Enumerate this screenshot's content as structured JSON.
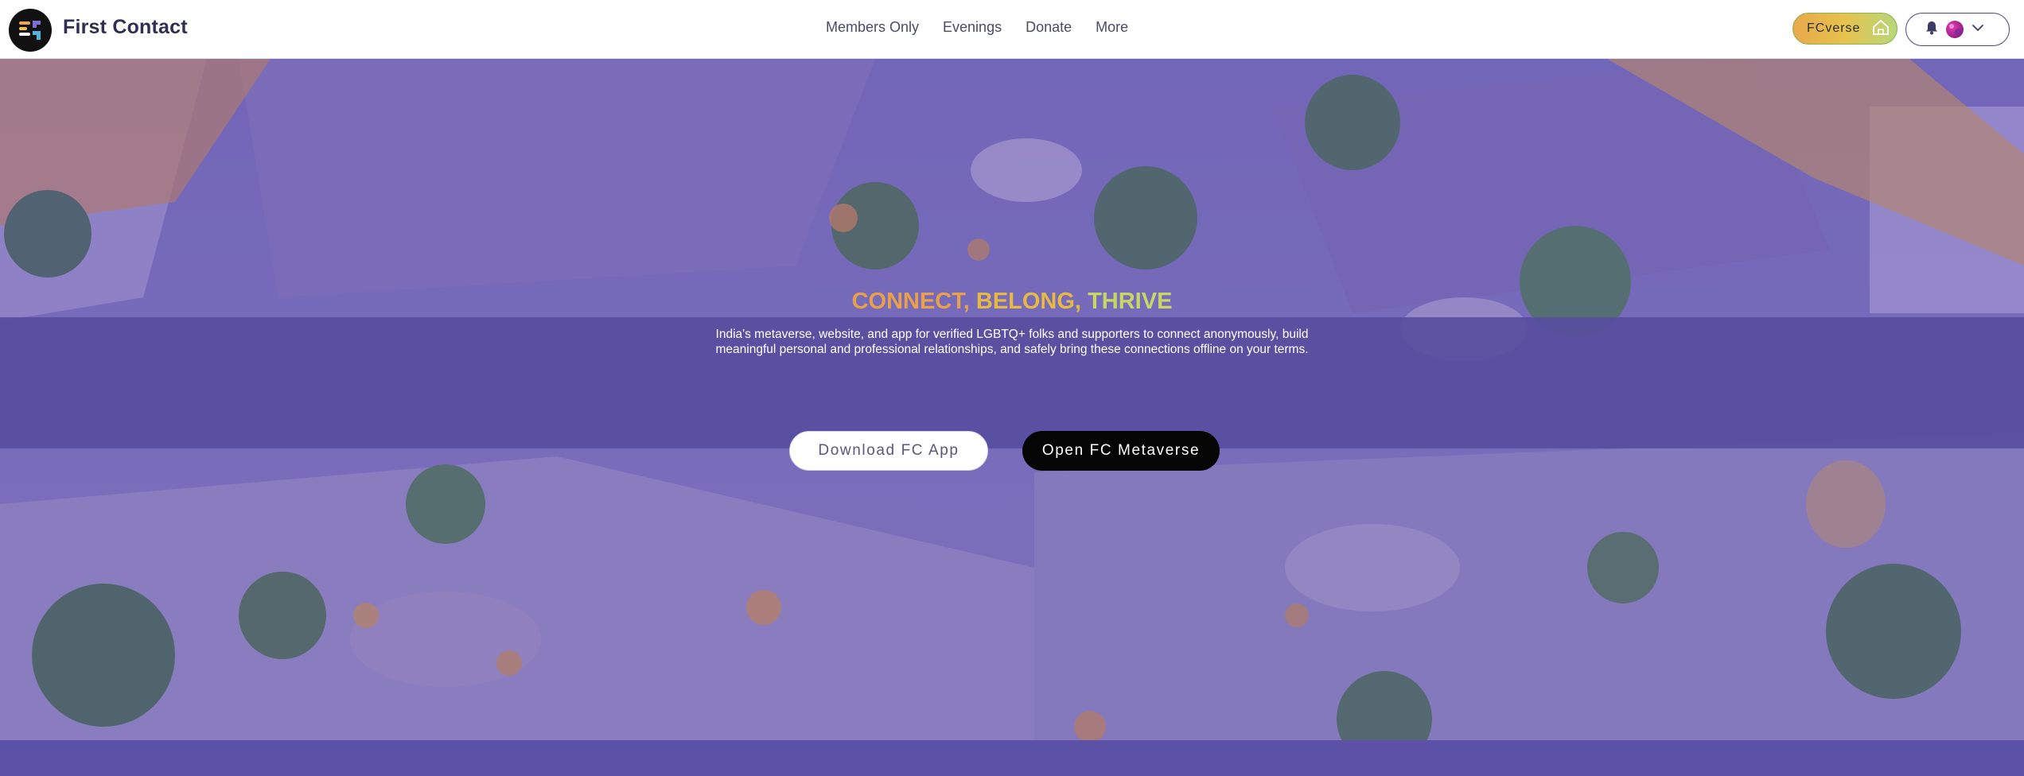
{
  "header": {
    "brand": "First Contact",
    "nav": [
      {
        "label": "Members Only"
      },
      {
        "label": "Evenings"
      },
      {
        "label": "Donate"
      },
      {
        "label": "More"
      }
    ],
    "fcverse_label": "FCverse"
  },
  "hero": {
    "tagline": {
      "word1": "CONNECT,",
      "word2": "BELONG,",
      "word3": "THRIVE"
    },
    "description_line1": "India's metaverse, website, and app for verified LGBTQ+ folks and supporters to connect anonymously, build",
    "description_line2": "meaningful personal and professional relationships, and safely bring these connections offline on your terms.",
    "download_button": "Download FC App",
    "metaverse_button": "Open FC Metaverse"
  },
  "colors": {
    "brand_text": "#2f2f55",
    "band": "#584ea0",
    "tagline_orange": "#e9a04a",
    "tagline_yellow": "#e7b843",
    "tagline_green": "#c8d763",
    "fcverse_gradient_start": "#e8a94a",
    "fcverse_gradient_end": "#b7d77a",
    "footer_strip": "#5b52a8"
  },
  "icons": {
    "logo": "first-contact-logo-icon",
    "fcverse": "house-icon",
    "notifications": "bell-icon",
    "dropdown": "chevron-down-icon"
  }
}
